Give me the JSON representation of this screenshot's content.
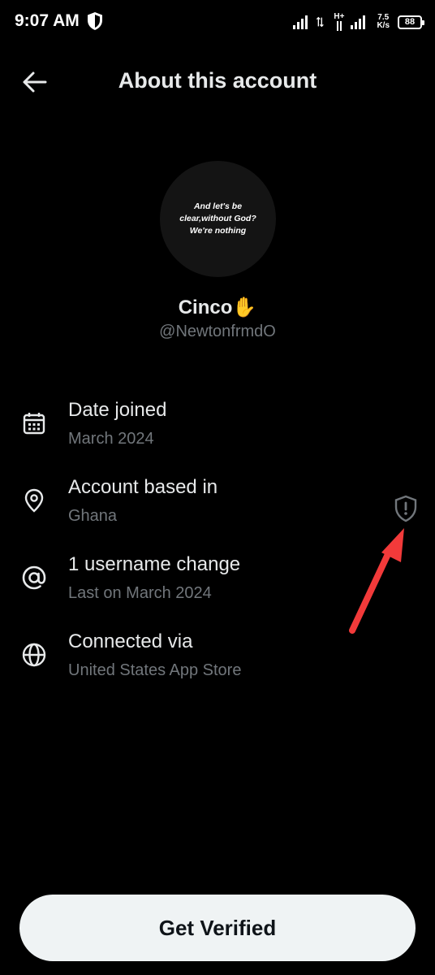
{
  "status_bar": {
    "time": "9:07 AM",
    "network_type": "H+",
    "speed_value": "7.5",
    "speed_unit": "K/s",
    "battery": "88"
  },
  "header": {
    "title": "About this account",
    "back_icon": "arrow-left-icon"
  },
  "profile": {
    "avatar_text_line1": "And let's be",
    "avatar_text_line2": "clear,without God?",
    "avatar_text_line3": "We're nothing",
    "display_name": "Cinco",
    "display_name_emoji": "✋",
    "handle": "@NewtonfrmdO"
  },
  "info_items": [
    {
      "label": "Date joined",
      "value": "March 2024",
      "icon": "calendar-icon"
    },
    {
      "label": "Account based in",
      "value": "Ghana",
      "icon": "location-pin-icon",
      "flag_icon": "shield-alert-icon"
    },
    {
      "label": "1 username change",
      "value": "Last on March 2024",
      "icon": "at-sign-icon"
    },
    {
      "label": "Connected via",
      "value": "United States App Store",
      "icon": "globe-icon"
    }
  ],
  "footer": {
    "button_label": "Get Verified"
  },
  "colors": {
    "background": "#000000",
    "primary_text": "#e7e9ea",
    "secondary_text": "#71767b",
    "button_bg": "#eff3f4",
    "annotation_arrow": "#f23a3a"
  }
}
